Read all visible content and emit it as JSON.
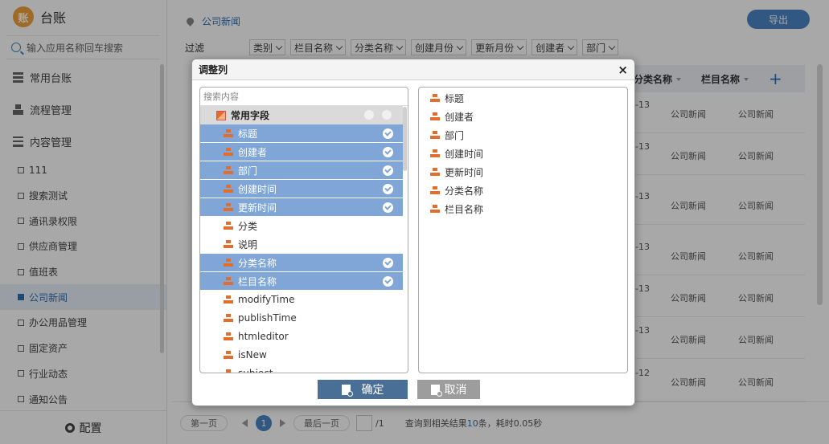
{
  "app": {
    "title": "台账",
    "logo_glyph": "账"
  },
  "sidebar": {
    "search_placeholder": "输入应用名称回车搜索",
    "groups": [
      "常用台账",
      "流程管理",
      "内容管理"
    ],
    "items": [
      {
        "label": "111",
        "active": false
      },
      {
        "label": "搜索测试",
        "active": false
      },
      {
        "label": "通讯录权限",
        "active": false
      },
      {
        "label": "供应商管理",
        "active": false
      },
      {
        "label": "值班表",
        "active": false
      },
      {
        "label": "公司新闻",
        "active": true
      },
      {
        "label": "办公用品管理",
        "active": false
      },
      {
        "label": "固定资产",
        "active": false
      },
      {
        "label": "行业动态",
        "active": false
      },
      {
        "label": "通知公告",
        "active": false
      }
    ],
    "config_label": "配置"
  },
  "main": {
    "breadcrumb": "公司新闻",
    "export_label": "导出",
    "filter_label": "过滤",
    "filters": [
      "类别",
      "栏目名称",
      "分类名称",
      "创建月份",
      "更新月份",
      "创建者",
      "部门"
    ],
    "table": {
      "headers": [
        "分类名称",
        "栏目名称"
      ],
      "rows": [
        {
          "date": "-13",
          "category": "公司新闻",
          "column": "公司新闻"
        },
        {
          "date": "-13",
          "category": "公司新闻",
          "column": "公司新闻"
        },
        {
          "date": "-13",
          "category": "公司新闻",
          "column": "公司新闻"
        },
        {
          "date": "-13",
          "category": "公司新闻",
          "column": "公司新闻"
        },
        {
          "date": "-13",
          "category": "公司新闻",
          "column": "公司新闻"
        },
        {
          "date": "-13",
          "category": "公司新闻",
          "column": "公司新闻"
        },
        {
          "date": "-12",
          "category": "公司新闻",
          "column": "公司新闻"
        }
      ]
    },
    "pager": {
      "first": "第一页",
      "current": "1",
      "last": "最后一页",
      "total": "/1",
      "summary_prefix": "查询到相关结果",
      "summary_count": "10",
      "summary_suffix": "条，耗时0.05秒"
    }
  },
  "dialog": {
    "title": "调整列",
    "close": "×",
    "search_placeholder": "搜索内容",
    "group_label": "常用字段",
    "fields": [
      {
        "label": "标题",
        "selected": true
      },
      {
        "label": "创建者",
        "selected": true
      },
      {
        "label": "部门",
        "selected": true
      },
      {
        "label": "创建时间",
        "selected": true
      },
      {
        "label": "更新时间",
        "selected": true
      },
      {
        "label": "分类",
        "selected": false
      },
      {
        "label": "说明",
        "selected": false
      },
      {
        "label": "分类名称",
        "selected": true
      },
      {
        "label": "栏目名称",
        "selected": true
      },
      {
        "label": "modifyTime",
        "selected": false
      },
      {
        "label": "publishTime",
        "selected": false
      },
      {
        "label": "htmleditor",
        "selected": false
      },
      {
        "label": "isNew",
        "selected": false
      },
      {
        "label": "subject",
        "selected": false
      }
    ],
    "selected_columns": [
      "标题",
      "创建者",
      "部门",
      "创建时间",
      "更新时间",
      "分类名称",
      "栏目名称"
    ],
    "ok_label": "确定",
    "cancel_label": "取消"
  }
}
